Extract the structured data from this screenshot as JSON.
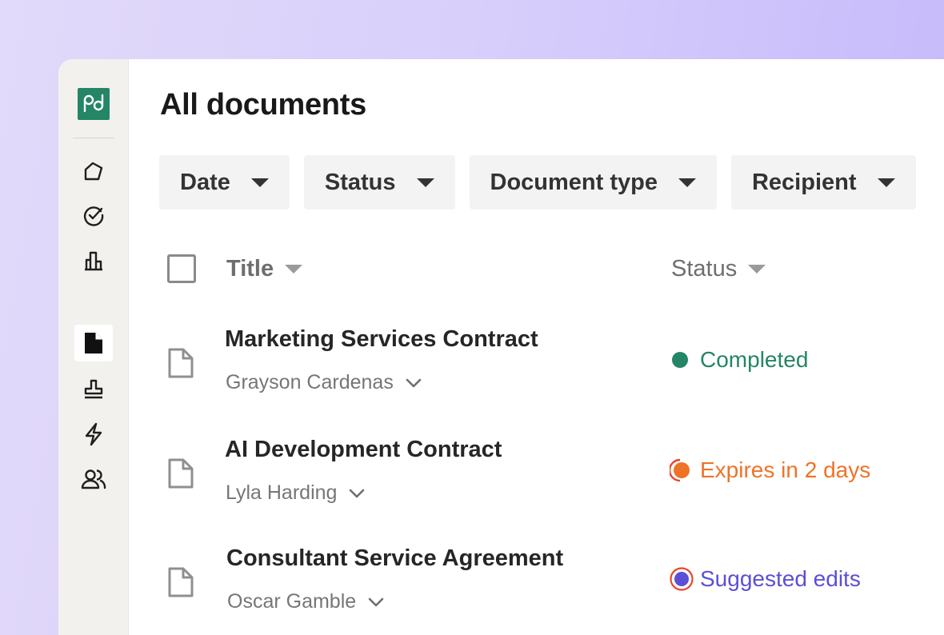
{
  "page": {
    "title": "All documents"
  },
  "sidebar": {
    "items": [
      {
        "name": "home",
        "icon": "home-icon"
      },
      {
        "name": "tasks",
        "icon": "check-circle-icon"
      },
      {
        "name": "reports",
        "icon": "bar-chart-icon"
      },
      {
        "name": "documents",
        "icon": "document-icon",
        "active": true
      },
      {
        "name": "notary",
        "icon": "stamp-icon"
      },
      {
        "name": "automation",
        "icon": "lightning-icon"
      },
      {
        "name": "contacts",
        "icon": "users-icon"
      }
    ]
  },
  "filters": [
    "Date",
    "Status",
    "Document type",
    "Recipient"
  ],
  "table": {
    "columns": {
      "title": "Title",
      "status": "Status"
    },
    "rows": [
      {
        "title": "Marketing Services Contract",
        "recipient": "Grayson Cardenas",
        "status": "Completed",
        "status_kind": "completed"
      },
      {
        "title": "AI Development Contract",
        "recipient": "Lyla Harding",
        "status": "Expires in 2 days",
        "status_kind": "expiring"
      },
      {
        "title": "Consultant Service Agreement",
        "recipient": "Oscar Gamble",
        "status": "Suggested edits",
        "status_kind": "suggested"
      }
    ]
  },
  "colors": {
    "brand": "#248567",
    "completed": "#248567",
    "expiring": "#ee7328",
    "suggested": "#5b4fd6",
    "background": "#d8cffb"
  }
}
